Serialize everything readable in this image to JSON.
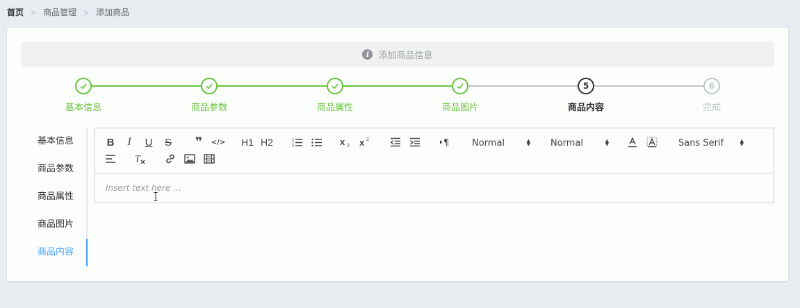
{
  "breadcrumb": {
    "home": "首页",
    "sep": ">",
    "level1": "商品管理",
    "level2": "添加商品"
  },
  "alert": {
    "icon": "info-icon",
    "icon_glyph": "i",
    "text": "添加商品信息"
  },
  "steps": [
    {
      "title": "基本信息",
      "status": "done"
    },
    {
      "title": "商品参数",
      "status": "done"
    },
    {
      "title": "商品属性",
      "status": "done"
    },
    {
      "title": "商品图片",
      "status": "done"
    },
    {
      "title": "商品内容",
      "status": "process",
      "number": "5"
    },
    {
      "title": "完成",
      "status": "wait",
      "number": "6"
    }
  ],
  "tabs": [
    {
      "label": "基本信息",
      "active": false
    },
    {
      "label": "商品参数",
      "active": false
    },
    {
      "label": "商品属性",
      "active": false
    },
    {
      "label": "商品图片",
      "active": false
    },
    {
      "label": "商品内容",
      "active": true
    }
  ],
  "editor": {
    "toolbar": {
      "bold": "B",
      "italic": "I",
      "underline": "U",
      "strike": "S",
      "blockquote": "❞",
      "code": "</>",
      "h1": "H1",
      "h2": "H2",
      "header_picker": "Normal",
      "size_picker": "Normal",
      "font_picker": "Sans Serif"
    },
    "placeholder": "Insert text here ..."
  },
  "colors": {
    "success": "#67c23a",
    "active": "#409eff",
    "text": "#303133",
    "wait": "#c0c4cc"
  }
}
